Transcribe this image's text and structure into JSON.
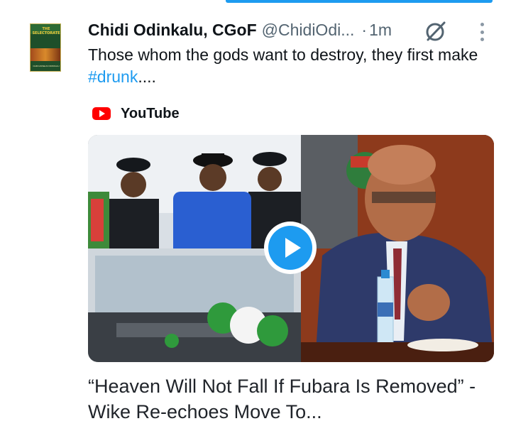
{
  "post": {
    "author_name": "Chidi Odinkalu, CGoF",
    "handle": "@ChidiOdi...",
    "separator": "·",
    "time": "1m",
    "text_plain": "Those whom the gods want to destroy, they first make ",
    "hashtag": "#drunk",
    "text_tail": "....",
    "avatar_icon": "book-cover-avatar",
    "avatar_title": "THE SELECTORATE",
    "avatar_author": "CHIDI ANSELM ODINKALU"
  },
  "card": {
    "source_icon": "youtube-icon",
    "source": "YouTube",
    "title": "“Heaven Will Not Fall If Fubara Is Removed” -Wike Re-echoes Move To...",
    "play_icon": "play-icon"
  },
  "icons": {
    "grok": "grok-icon",
    "more": "more-options-icon"
  },
  "colors": {
    "accent": "#1d9bf0",
    "text": "#0f1419",
    "secondary": "#536471",
    "youtube_red": "#ff0000"
  }
}
